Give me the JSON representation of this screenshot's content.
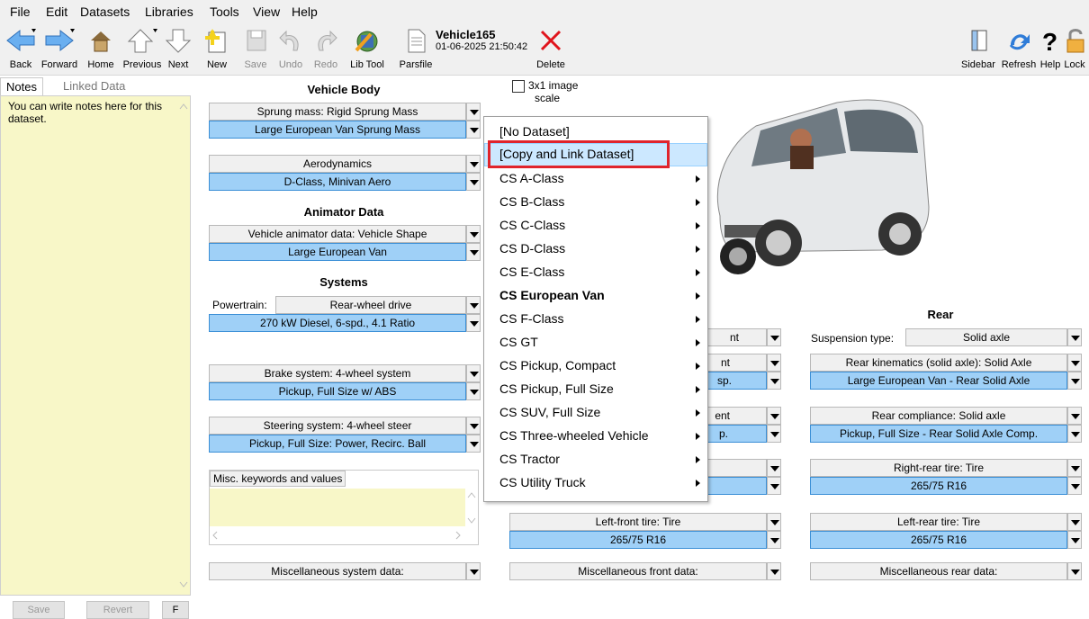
{
  "menubar": [
    "File",
    "Edit",
    "Datasets",
    "Libraries",
    "Tools",
    "View",
    "Help"
  ],
  "toolbar": {
    "back": "Back",
    "forward": "Forward",
    "home": "Home",
    "previous": "Previous",
    "next": "Next",
    "new": "New",
    "save": "Save",
    "undo": "Undo",
    "redo": "Redo",
    "libtool": "Lib Tool",
    "parsfile": "Parsfile",
    "dataset_title": "Vehicle165",
    "dataset_date": "01-06-2025 21:50:42",
    "delete": "Delete",
    "sidebar": "Sidebar",
    "refresh": "Refresh",
    "help": "Help",
    "lock": "Lock"
  },
  "notes": {
    "tab_notes": "Notes",
    "tab_linked": "Linked Data",
    "text": "You can write notes here for this dataset.",
    "save": "Save",
    "revert": "Revert",
    "third": "F"
  },
  "vehicle_body": {
    "title": "Vehicle Body",
    "sprung_label": "Sprung mass: Rigid Sprung Mass",
    "sprung_value": "Large European Van Sprung Mass",
    "aero_label": "Aerodynamics",
    "aero_value": "D-Class, Minivan Aero"
  },
  "animator": {
    "title": "Animator Data",
    "shape_label": "Vehicle animator data: Vehicle Shape",
    "shape_value": "Large European Van"
  },
  "systems": {
    "title": "Systems",
    "powertrain_label": "Powertrain:",
    "powertrain_type": "Rear-wheel drive",
    "powertrain_value": "270 kW Diesel, 6-spd., 4.1 Ratio",
    "brake_label": "Brake system: 4-wheel system",
    "brake_value": "Pickup, Full Size w/ ABS",
    "steer_label": "Steering system: 4-wheel steer",
    "steer_value": "Pickup, Full Size: Power, Recirc. Ball",
    "misc_label": "Misc. keywords and values",
    "misc_sys": "Miscellaneous system data:"
  },
  "image": {
    "checkbox_label_1": "3x1 image",
    "checkbox_label_2": "scale"
  },
  "front": {
    "frag1": "nt",
    "frag2": "nt",
    "frag3": "sp.",
    "frag4": "ent",
    "frag5": "p.",
    "lf_label": "Left-front tire: Tire",
    "lf_value": "265/75 R16",
    "misc": "Miscellaneous front data:"
  },
  "rear": {
    "title": "Rear",
    "susp_label": "Suspension type:",
    "susp_value": "Solid axle",
    "kin_label": "Rear kinematics (solid axle): Solid Axle",
    "kin_value": "Large European Van - Rear Solid Axle",
    "comp_label": "Rear compliance: Solid axle",
    "comp_value": "Pickup, Full Size - Rear Solid Axle Comp.",
    "rr_label": "Right-rear tire: Tire",
    "rr_value": "265/75 R16",
    "lr_label": "Left-rear tire: Tire",
    "lr_value": "265/75 R16",
    "misc": "Miscellaneous rear data:"
  },
  "context_menu": {
    "items": [
      "[No Dataset]",
      "[Copy and Link Dataset]",
      "CS A-Class",
      "CS B-Class",
      "CS C-Class",
      "CS D-Class",
      "CS E-Class",
      "CS European Van",
      "CS F-Class",
      "CS GT",
      "CS Pickup, Compact",
      "CS Pickup, Full Size",
      "CS SUV, Full Size",
      "CS Three-wheeled Vehicle",
      "CS Tractor",
      "CS Utility Truck"
    ],
    "highlight_color": "#cce8ff",
    "annotation_color": "#e0242c"
  }
}
